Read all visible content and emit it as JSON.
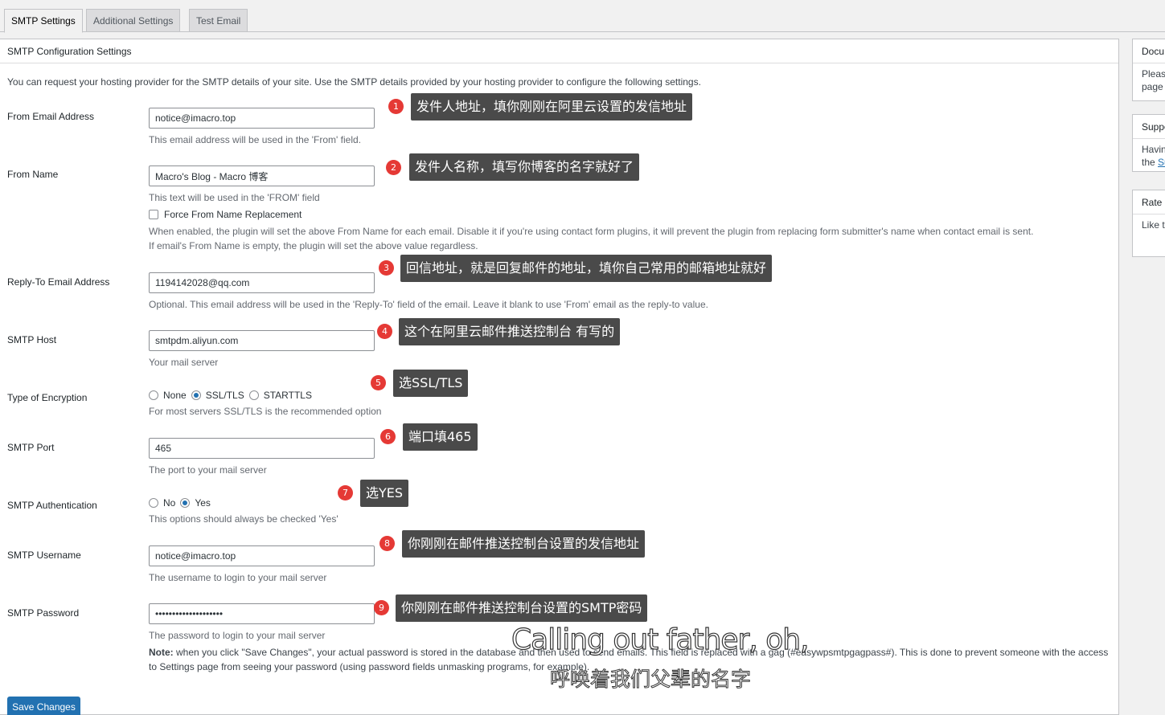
{
  "tabs": [
    "SMTP Settings",
    "Additional Settings",
    "Test Email"
  ],
  "section_title": "SMTP Configuration Settings",
  "intro": "You can request your hosting provider for the SMTP details of your site. Use the SMTP details provided by your hosting provider to configure the following settings.",
  "from_email": {
    "label": "From Email Address",
    "value": "notice@imacro.top",
    "desc": "This email address will be used in the 'From' field."
  },
  "from_name": {
    "label": "From Name",
    "value": "Macro's Blog - Macro 博客",
    "desc": "This text will be used in the 'FROM' field",
    "force_label": "Force From Name Replacement",
    "force_desc1": "When enabled, the plugin will set the above From Name for each email. Disable it if you're using contact form plugins, it will prevent the plugin from replacing form submitter's name when contact email is sent.",
    "force_desc2": "If email's From Name is empty, the plugin will set the above value regardless."
  },
  "reply_to": {
    "label": "Reply-To Email Address",
    "value": "1194142028@qq.com",
    "desc": "Optional. This email address will be used in the 'Reply-To' field of the email. Leave it blank to use 'From' email as the reply-to value."
  },
  "smtp_host": {
    "label": "SMTP Host",
    "value": "smtpdm.aliyun.com",
    "desc": "Your mail server"
  },
  "encryption": {
    "label": "Type of Encryption",
    "options": [
      "None",
      "SSL/TLS",
      "STARTTLS"
    ],
    "selected": "SSL/TLS",
    "desc": "For most servers SSL/TLS is the recommended option"
  },
  "smtp_port": {
    "label": "SMTP Port",
    "value": "465",
    "desc": "The port to your mail server"
  },
  "auth": {
    "label": "SMTP Authentication",
    "options": [
      "No",
      "Yes"
    ],
    "selected": "Yes",
    "desc": "This options should always be checked 'Yes'"
  },
  "username": {
    "label": "SMTP Username",
    "value": "notice@imacro.top",
    "desc": "The username to login to your mail server"
  },
  "password": {
    "label": "SMTP Password",
    "value": "••••••••••••••••••••",
    "desc": "The password to login to your mail server",
    "note_bold": "Note:",
    "note_a": " when you click \"Save Changes\", your actual password is stored in the database and then used to send emails. This field is replaced with a gag (#easywpsmtpgagpass#). This is done to prevent someone with the access",
    "note_b": "to Settings page from seeing your password (using password fields unmasking programs, for example)."
  },
  "save_label": "Save Changes",
  "callouts": [
    {
      "num": "1",
      "text": "发件人地址，填你刚刚在阿里云设置的发信地址"
    },
    {
      "num": "2",
      "text": "发件人名称，填写你博客的名字就好了"
    },
    {
      "num": "3",
      "text": "回信地址，就是回复邮件的地址，填你自己常用的邮箱地址就好"
    },
    {
      "num": "4",
      "text": "这个在阿里云邮件推送控制台 有写的"
    },
    {
      "num": "5",
      "text": "选SSL/TLS"
    },
    {
      "num": "6",
      "text": "端口填465"
    },
    {
      "num": "7",
      "text": "选YES"
    },
    {
      "num": "8",
      "text": "你刚刚在邮件推送控制台设置的发信地址"
    },
    {
      "num": "9",
      "text": "你刚刚在邮件推送控制台设置的SMTP密码"
    }
  ],
  "subtitles": {
    "en": "Calling out father, oh,",
    "zh": "呼唤着我们父辈的名字"
  },
  "sidebar": {
    "docs": {
      "title": "Docu",
      "line1": "Please",
      "line2": "page"
    },
    "support": {
      "title": "Suppo",
      "line1": "Havin",
      "line2_text": "the ",
      "line2_link": "Su"
    },
    "rate": {
      "title": "Rate",
      "line1": "Like t"
    }
  },
  "colors": {
    "accent": "#2271b1",
    "callout_bg": "#4a4a4a",
    "badge": "#e53935"
  }
}
